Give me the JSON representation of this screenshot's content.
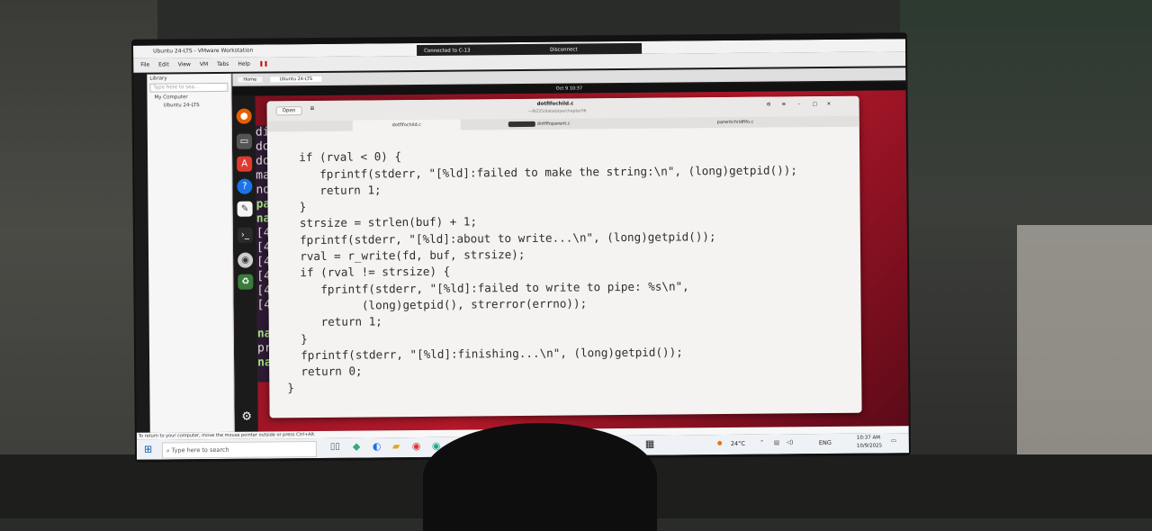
{
  "vmware": {
    "title": "Ubuntu 24-LTS - VMware Workstation",
    "menu": [
      "File",
      "Edit",
      "View",
      "VM",
      "Tabs",
      "Help"
    ],
    "connected": "Connected to C-13",
    "disconnect": "Disconnect",
    "library_title": "Library",
    "library_search": "Type here to sea...",
    "tree": [
      "My Computer",
      "Ubuntu 24-LTS"
    ],
    "tab_home": "Home",
    "tab_vm": "Ubuntu 24-LTS"
  },
  "gnome": {
    "clock": "Oct 9  10:37"
  },
  "editor": {
    "open_label": "Open",
    "filename": "dotfifochild.c",
    "path": "~/NZ25/data/pipe/chapter06",
    "tabs": [
      "dotfifochild.c",
      "dotfifoparent.c",
      "parentchildfifo.c"
    ],
    "code": [
      "  if (rval < 0) {",
      "     fprintf(stderr, \"[%ld]:failed to make the string:\\n\", (long)getpid());",
      "     return 1;",
      "  }",
      "  strsize = strlen(buf) + 1;",
      "  fprintf(stderr, \"[%ld]:about to write...\\n\", (long)getpid());",
      "  rval = r_write(fd, buf, strsize);",
      "  if (rval != strsize) {",
      "     fprintf(stderr, \"[%ld]:failed to write to pipe: %s\\n\",",
      "           (long)getpid(), strerror(errno));",
      "     return 1;",
      "  }",
      "  fprintf(stderr, \"[%ld]:finishing...\\n\", (long)getpid());",
      "  return 0;",
      "}"
    ]
  },
  "terminal_lines": [
    "dif",
    "dof",
    "dof",
    "mak",
    "non",
    "par",
    "nad",
    "[48",
    "[48",
    "[48",
    "[48",
    "[48",
    "[48",
    "",
    "nad",
    "prw",
    "nad"
  ],
  "windows": {
    "status": "To return to your computer, move the mouse pointer outside or press Ctrl+Alt.",
    "search_placeholder": "Type here to search",
    "weather": "24°C",
    "lang": "ENG",
    "time": "10:37 AM",
    "date": "10/9/2025"
  }
}
